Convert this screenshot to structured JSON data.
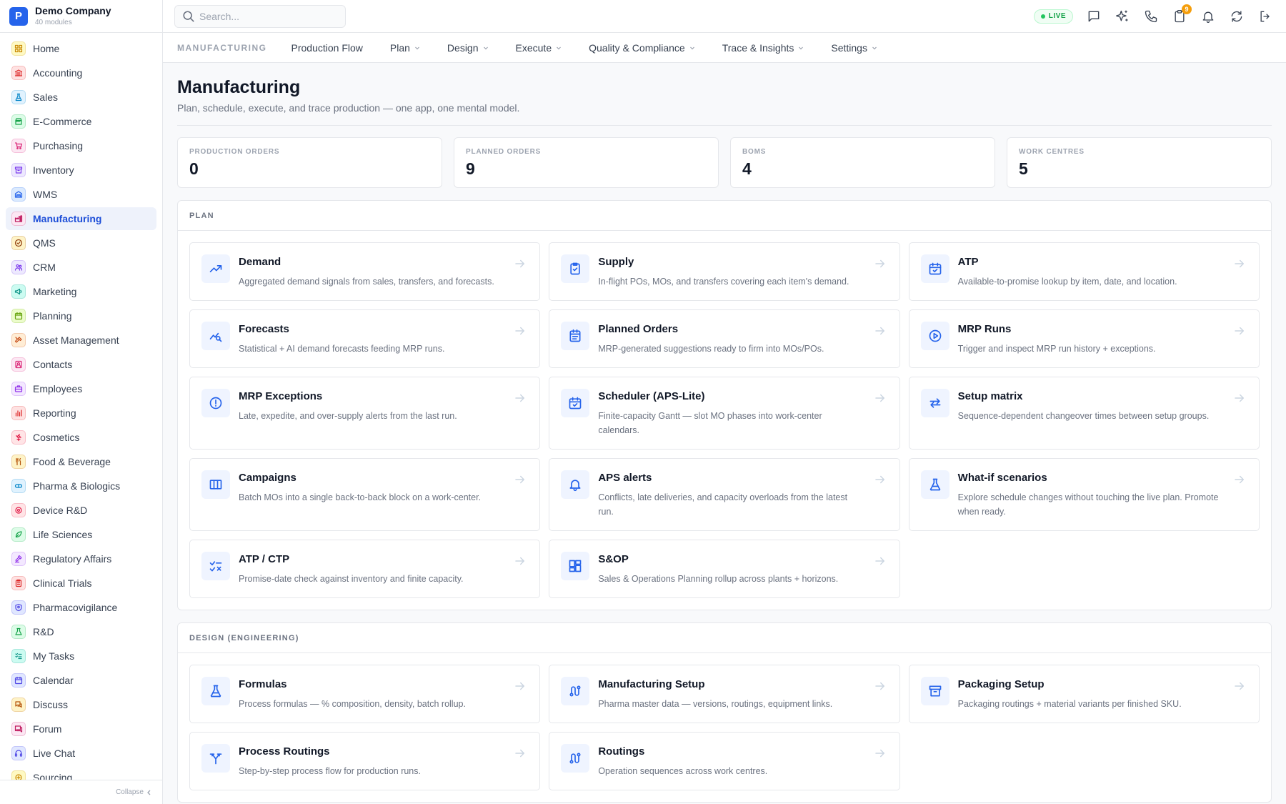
{
  "company": {
    "logo_letter": "P",
    "name": "Demo Company",
    "modules": "40 modules"
  },
  "sidebar": {
    "items": [
      {
        "label": "Home",
        "icon": "grid-icon",
        "color": "#ca8a04",
        "bg": "#fef9c3"
      },
      {
        "label": "Accounting",
        "icon": "bank-icon",
        "color": "#dc2626",
        "bg": "#fee2e2"
      },
      {
        "label": "Sales",
        "icon": "flask-icon",
        "color": "#0284c7",
        "bg": "#e0f2fe"
      },
      {
        "label": "E-Commerce",
        "icon": "store-icon",
        "color": "#16a34a",
        "bg": "#dcfce7"
      },
      {
        "label": "Purchasing",
        "icon": "cart-icon",
        "color": "#db2777",
        "bg": "#fce7f3"
      },
      {
        "label": "Inventory",
        "icon": "archive-icon",
        "color": "#7c3aed",
        "bg": "#ede9fe"
      },
      {
        "label": "WMS",
        "icon": "warehouse-icon",
        "color": "#2563eb",
        "bg": "#dbeafe"
      },
      {
        "label": "Manufacturing",
        "icon": "factory-icon",
        "color": "#be185d",
        "bg": "#fce7f3"
      },
      {
        "label": "QMS",
        "icon": "check-circle-icon",
        "color": "#92400e",
        "bg": "#fef3c7"
      },
      {
        "label": "CRM",
        "icon": "users-icon",
        "color": "#7c3aed",
        "bg": "#ede9fe"
      },
      {
        "label": "Marketing",
        "icon": "megaphone-icon",
        "color": "#0d9488",
        "bg": "#ccfbf1"
      },
      {
        "label": "Planning",
        "icon": "calendar-icon",
        "color": "#65a30d",
        "bg": "#ecfccb"
      },
      {
        "label": "Asset Management",
        "icon": "tools-icon",
        "color": "#c2410c",
        "bg": "#ffedd5"
      },
      {
        "label": "Contacts",
        "icon": "contact-icon",
        "color": "#db2777",
        "bg": "#fce7f3"
      },
      {
        "label": "Employees",
        "icon": "briefcase-icon",
        "color": "#9333ea",
        "bg": "#f3e8ff"
      },
      {
        "label": "Reporting",
        "icon": "bar-chart-icon",
        "color": "#dc2626",
        "bg": "#fee2e2"
      },
      {
        "label": "Cosmetics",
        "icon": "flower-icon",
        "color": "#e11d48",
        "bg": "#ffe4e6"
      },
      {
        "label": "Food & Beverage",
        "icon": "utensils-icon",
        "color": "#b45309",
        "bg": "#fef3c7"
      },
      {
        "label": "Pharma & Biologics",
        "icon": "pill-icon",
        "color": "#0284c7",
        "bg": "#e0f2fe"
      },
      {
        "label": "Device R&D",
        "icon": "device-icon",
        "color": "#e11d48",
        "bg": "#ffe4e6"
      },
      {
        "label": "Life Sciences",
        "icon": "leaf-icon",
        "color": "#16a34a",
        "bg": "#dcfce7"
      },
      {
        "label": "Regulatory Affairs",
        "icon": "gavel-icon",
        "color": "#9333ea",
        "bg": "#f3e8ff"
      },
      {
        "label": "Clinical Trials",
        "icon": "clipboard-icon",
        "color": "#dc2626",
        "bg": "#fee2e2"
      },
      {
        "label": "Pharmacovigilance",
        "icon": "shield-icon",
        "color": "#4f46e5",
        "bg": "#e0e7ff"
      },
      {
        "label": "R&D",
        "icon": "beaker-icon",
        "color": "#16a34a",
        "bg": "#dcfce7"
      },
      {
        "label": "My Tasks",
        "icon": "tasks-icon",
        "color": "#0d9488",
        "bg": "#ccfbf1"
      },
      {
        "label": "Calendar",
        "icon": "calendar-icon",
        "color": "#4f46e5",
        "bg": "#e0e7ff"
      },
      {
        "label": "Discuss",
        "icon": "chat-icon",
        "color": "#b45309",
        "bg": "#fef3c7"
      },
      {
        "label": "Forum",
        "icon": "forum-icon",
        "color": "#be185d",
        "bg": "#fce7f3"
      },
      {
        "label": "Live Chat",
        "icon": "headset-icon",
        "color": "#4f46e5",
        "bg": "#e0e7ff"
      },
      {
        "label": "Sourcing",
        "icon": "sourcing-icon",
        "color": "#ca8a04",
        "bg": "#fef9c3"
      }
    ],
    "active": "Manufacturing",
    "collapse_label": "Collapse"
  },
  "topbar": {
    "search_placeholder": "Search...",
    "live_label": "LIVE",
    "notification_count": "9"
  },
  "subnav": {
    "title": "MANUFACTURING",
    "items": [
      {
        "label": "Production Flow",
        "dropdown": false
      },
      {
        "label": "Plan",
        "dropdown": true
      },
      {
        "label": "Design",
        "dropdown": true
      },
      {
        "label": "Execute",
        "dropdown": true
      },
      {
        "label": "Quality & Compliance",
        "dropdown": true
      },
      {
        "label": "Trace & Insights",
        "dropdown": true
      },
      {
        "label": "Settings",
        "dropdown": true
      }
    ]
  },
  "page": {
    "title": "Manufacturing",
    "subtitle": "Plan, schedule, execute, and trace production — one app, one mental model."
  },
  "stats": [
    {
      "label": "PRODUCTION ORDERS",
      "value": "0"
    },
    {
      "label": "PLANNED ORDERS",
      "value": "9"
    },
    {
      "label": "BOMS",
      "value": "4"
    },
    {
      "label": "WORK CENTRES",
      "value": "5"
    }
  ],
  "sections": [
    {
      "title": "PLAN",
      "cards": [
        {
          "title": "Demand",
          "desc": "Aggregated demand signals from sales, transfers, and forecasts.",
          "icon": "trend-up-icon"
        },
        {
          "title": "Supply",
          "desc": "In-flight POs, MOs, and transfers covering each item's demand.",
          "icon": "clipboard-check-icon"
        },
        {
          "title": "ATP",
          "desc": "Available-to-promise lookup by item, date, and location.",
          "icon": "calendar-check-icon"
        },
        {
          "title": "Forecasts",
          "desc": "Statistical + AI demand forecasts feeding MRP runs.",
          "icon": "chart-search-icon"
        },
        {
          "title": "Planned Orders",
          "desc": "MRP-generated suggestions ready to firm into MOs/POs.",
          "icon": "list-calendar-icon"
        },
        {
          "title": "MRP Runs",
          "desc": "Trigger and inspect MRP run history + exceptions.",
          "icon": "play-circle-icon"
        },
        {
          "title": "MRP Exceptions",
          "desc": "Late, expedite, and over-supply alerts from the last run.",
          "icon": "alert-circle-icon"
        },
        {
          "title": "Scheduler (APS-Lite)",
          "desc": "Finite-capacity Gantt — slot MO phases into work-center calendars.",
          "icon": "calendar-check-icon"
        },
        {
          "title": "Setup matrix",
          "desc": "Sequence-dependent changeover times between setup groups.",
          "icon": "swap-icon"
        },
        {
          "title": "Campaigns",
          "desc": "Batch MOs into a single back-to-back block on a work-center.",
          "icon": "columns-icon"
        },
        {
          "title": "APS alerts",
          "desc": "Conflicts, late deliveries, and capacity overloads from the latest run.",
          "icon": "bell-icon"
        },
        {
          "title": "What-if scenarios",
          "desc": "Explore schedule changes without touching the live plan. Promote when ready.",
          "icon": "flask-icon"
        },
        {
          "title": "ATP / CTP",
          "desc": "Promise-date check against inventory and finite capacity.",
          "icon": "check-x-icon"
        },
        {
          "title": "S&OP",
          "desc": "Sales & Operations Planning rollup across plants + horizons.",
          "icon": "dashboard-icon"
        }
      ]
    },
    {
      "title": "DESIGN (ENGINEERING)",
      "cards": [
        {
          "title": "Formulas",
          "desc": "Process formulas — % composition, density, batch rollup.",
          "icon": "flask-icon"
        },
        {
          "title": "Manufacturing Setup",
          "desc": "Pharma master data — versions, routings, equipment links.",
          "icon": "route-icon"
        },
        {
          "title": "Packaging Setup",
          "desc": "Packaging routings + material variants per finished SKU.",
          "icon": "archive-icon"
        },
        {
          "title": "Process Routings",
          "desc": "Step-by-step process flow for production runs.",
          "icon": "split-icon"
        },
        {
          "title": "Routings",
          "desc": "Operation sequences across work centres.",
          "icon": "route-icon"
        }
      ]
    }
  ],
  "colors": {
    "accent": "#2563eb",
    "icon_bg": "#eff4ff"
  }
}
